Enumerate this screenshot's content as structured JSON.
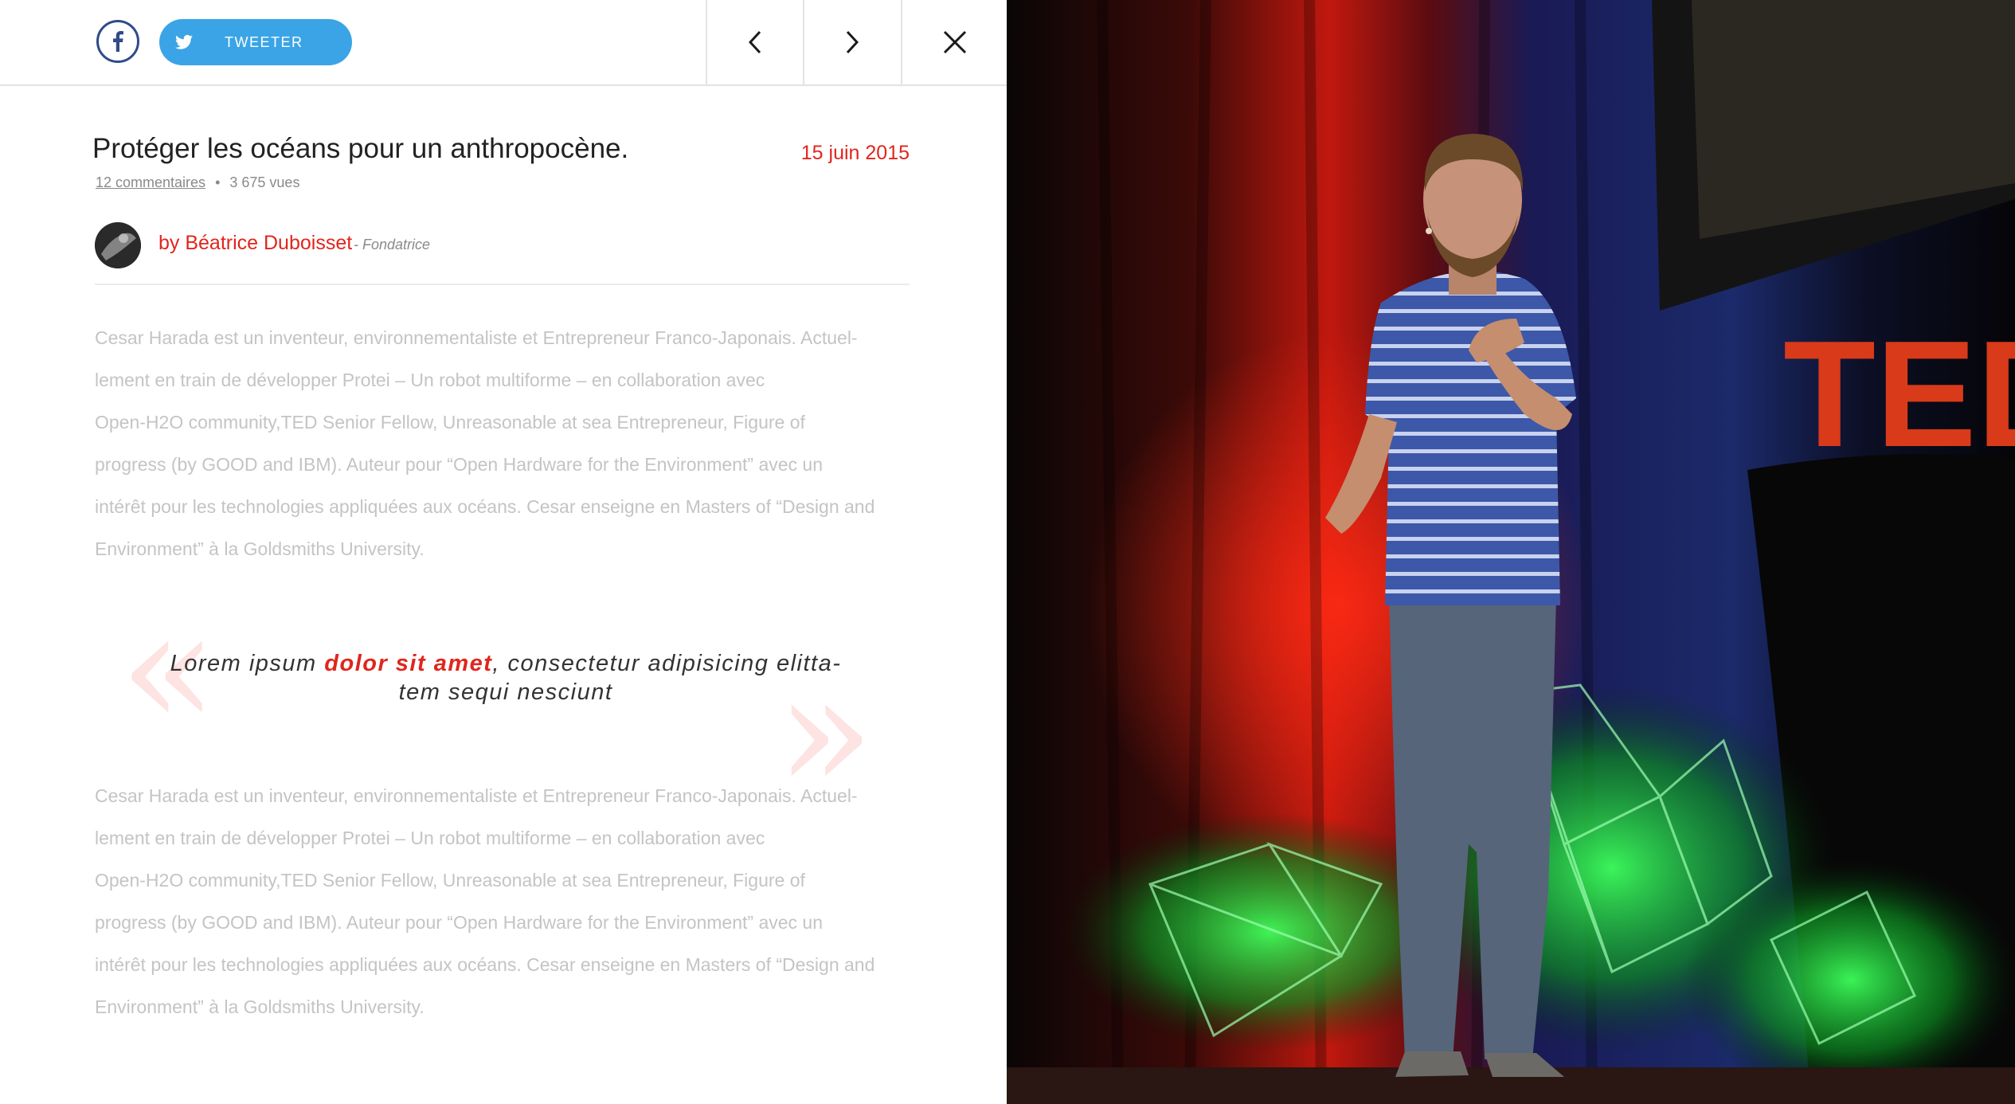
{
  "share": {
    "facebook_icon": "facebook-icon",
    "twitter_label": "TWEETER",
    "twitter_icon": "twitter-icon"
  },
  "nav": {
    "prev_icon": "chevron-left-icon",
    "next_icon": "chevron-right-icon",
    "close_icon": "close-icon"
  },
  "article": {
    "title": "Protéger les océans pour un anthropocène.",
    "date": "15 juin 2015",
    "comments": "12 commentaires",
    "separator": "•",
    "views": "3 675 vues",
    "author": "by Béatrice Duboisset",
    "author_role": "- Fondatrice",
    "paragraph1": [
      "Cesar Harada est un inventeur, environnementaliste et Entrepreneur Franco-Japonais. Actuel-",
      "lement en train de développer Protei – Un robot multiforme – en collaboration avec",
      "Open-H2O community,TED Senior Fellow, Unreasonable at sea Entrepreneur, Figure of",
      "progress (by GOOD and IBM). Auteur pour “Open Hardware for the Environment” avec un",
      "intérêt pour les technologies appliquées aux océans. Cesar enseigne en Masters of “Design and",
      "Environment” à la Goldsmiths University."
    ],
    "quote": {
      "open_mark": "«",
      "close_mark": "»",
      "before": "Lorem ipsum ",
      "highlight": "dolor sit amet",
      "after_line1": ", consectetur adipisicing elitta-",
      "line2": "tem sequi nesciunt"
    },
    "paragraph2": [
      "Cesar Harada est un inventeur, environnementaliste et Entrepreneur Franco-Japonais. Actuel-",
      "lement en train de développer Protei – Un robot multiforme – en collaboration avec",
      "Open-H2O community,TED Senior Fellow, Unreasonable at sea Entrepreneur, Figure of",
      "progress (by GOOD and IBM). Auteur pour “Open Hardware for the Environment” avec un",
      "intérêt pour les technologies appliquées aux océans. Cesar enseigne en Masters of “Design and",
      "Environment” à la Goldsmiths University."
    ]
  },
  "photo": {
    "stage_sign": "TED"
  },
  "colors": {
    "accent": "#e0261d",
    "facebook": "#2f4b8a",
    "twitter": "#3aa4e6",
    "body_text": "#c4c4c4"
  }
}
